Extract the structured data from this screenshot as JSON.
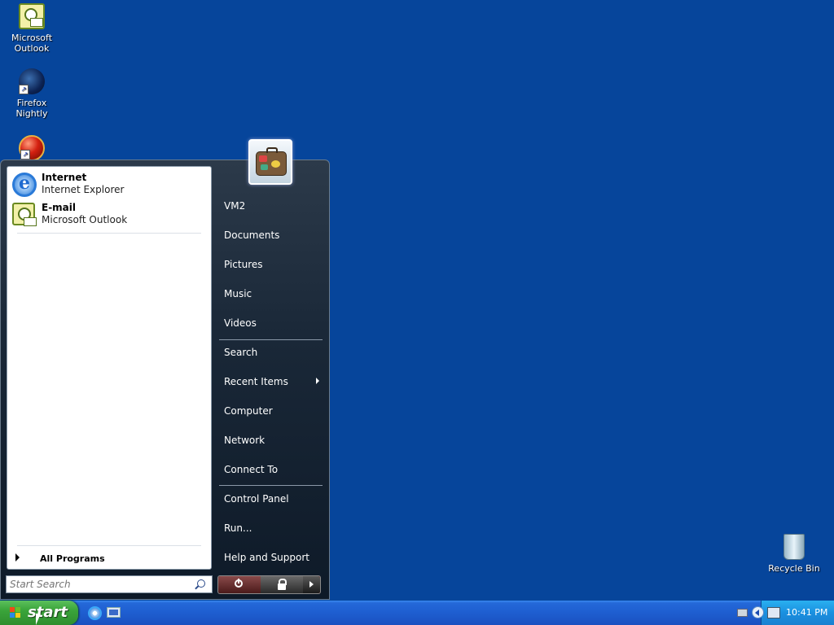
{
  "desktop": {
    "icons": [
      {
        "label": "Microsoft Outlook",
        "icon": "outlook-icon"
      },
      {
        "label": "Firefox Nightly",
        "icon": "firefox-nightly-icon"
      },
      {
        "label": "",
        "icon": "red-ball-icon"
      },
      {
        "label": "Recycle Bin",
        "icon": "recycle-bin-icon"
      }
    ]
  },
  "start_menu": {
    "pinned": [
      {
        "title": "Internet",
        "subtitle": "Internet Explorer",
        "icon": "internet-explorer-icon"
      },
      {
        "title": "E-mail",
        "subtitle": "Microsoft Outlook",
        "icon": "outlook-icon"
      }
    ],
    "all_programs": "All Programs",
    "search_placeholder": "Start Search",
    "user_picture": "user-picture-suitcase-icon",
    "right_items": [
      {
        "label": "VM2"
      },
      {
        "label": "Documents"
      },
      {
        "label": "Pictures"
      },
      {
        "label": "Music"
      },
      {
        "label": "Videos"
      },
      {
        "label": "Search"
      },
      {
        "label": "Recent Items",
        "submenu": true
      },
      {
        "label": "Computer"
      },
      {
        "label": "Network"
      },
      {
        "label": "Connect To"
      },
      {
        "label": "Control Panel"
      },
      {
        "label": "Run..."
      },
      {
        "label": "Help and Support"
      }
    ],
    "power_buttons": [
      "power-icon",
      "lock-icon",
      "more-options-arrow-icon"
    ]
  },
  "taskbar": {
    "start_label": "start",
    "quick_launch": [
      "internet-explorer-icon",
      "show-desktop-icon"
    ],
    "tray_icons": [
      "keyboard-icon",
      "show-hidden-icons-chevron",
      "network-icon"
    ],
    "clock": "10:41 PM"
  },
  "colors": {
    "desktop_bg": "#06459b",
    "taskbar": "#1e5ed0",
    "start_button": "#3aa43a",
    "start_menu_dark": "#1a2838"
  }
}
